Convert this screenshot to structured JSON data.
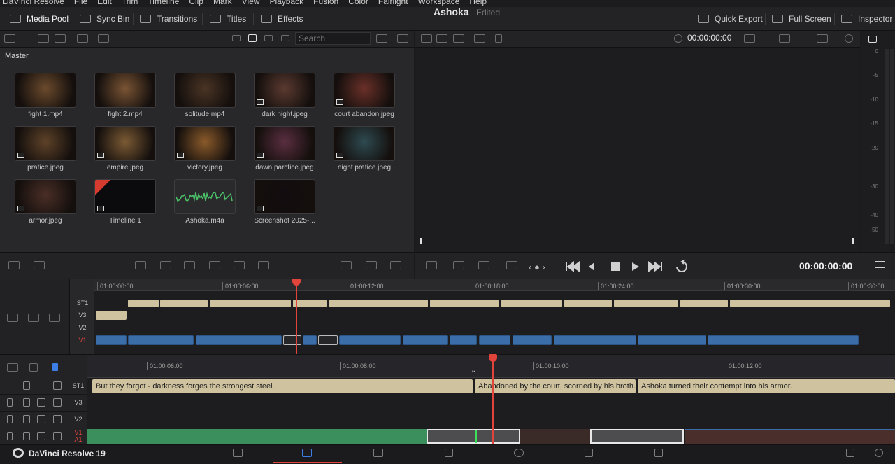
{
  "menu": [
    "DaVinci Resolve",
    "File",
    "Edit",
    "Trim",
    "Timeline",
    "Clip",
    "Mark",
    "View",
    "Playback",
    "Fusion",
    "Color",
    "Fairlight",
    "Workspace",
    "Help"
  ],
  "toolbar": {
    "media_pool": "Media Pool",
    "sync_bin": "Sync Bin",
    "transitions": "Transitions",
    "titles": "Titles",
    "effects": "Effects",
    "quick_export": "Quick Export",
    "full_screen": "Full Screen",
    "inspector": "Inspector"
  },
  "project": {
    "title": "Ashoka",
    "status": "Edited"
  },
  "media_pool": {
    "search_placeholder": "Search",
    "bin": "Master",
    "clips": [
      {
        "name": "fight 1.mp4",
        "kind": "video",
        "color": "#6b4a2c"
      },
      {
        "name": "fight 2.mp4",
        "kind": "video",
        "color": "#7a5434"
      },
      {
        "name": "solitude.mp4",
        "kind": "video",
        "color": "#4a3424"
      },
      {
        "name": "dark night.jpeg",
        "kind": "image",
        "color": "#5b3a30"
      },
      {
        "name": "court abandon.jpeg",
        "kind": "image",
        "color": "#6a3028"
      },
      {
        "name": "pratice.jpeg",
        "kind": "image",
        "color": "#5e4228"
      },
      {
        "name": "empire.jpeg",
        "kind": "image",
        "color": "#7b5a34"
      },
      {
        "name": "victory.jpeg",
        "kind": "image",
        "color": "#8a5a2a"
      },
      {
        "name": "dawn parctice.jpeg",
        "kind": "image",
        "color": "#5a2e40"
      },
      {
        "name": "night pratice.jpeg",
        "kind": "image",
        "color": "#2e4a50"
      },
      {
        "name": "armor.jpeg",
        "kind": "image",
        "color": "#4a2e26"
      },
      {
        "name": "Timeline 1",
        "kind": "timeline",
        "color": "#0b0b0d"
      },
      {
        "name": "Ashoka.m4a",
        "kind": "audio",
        "color": "#2a2a2d"
      },
      {
        "name": "Screenshot 2025-...",
        "kind": "image",
        "color": "#120c0e"
      }
    ]
  },
  "viewer": {
    "timecode_top": "00:00:00:00",
    "timecode": "00:00:00:00"
  },
  "meter": [
    "0",
    "-5",
    "-10",
    "-15",
    "-20",
    "-30",
    "-40",
    "-50"
  ],
  "upper_timeline": {
    "ruler": [
      "01:00:00:00",
      "01:00:06:00",
      "01:00:12:00",
      "01:00:18:00",
      "01:00:24:00",
      "01:00:30:00",
      "01:00:36:00"
    ],
    "tracks": [
      "ST1",
      "V3",
      "V2",
      "V1"
    ]
  },
  "lower_timeline": {
    "ruler": [
      "01:00:06:00",
      "01:00:08:00",
      "01:00:10:00",
      "01:00:12:00"
    ],
    "tracks": [
      "ST1",
      "V3",
      "V2",
      "V1",
      "A1"
    ],
    "subtitles": [
      "But they forgot - darkness forges the strongest steel.",
      "Abandoned by the court, scorned by his broth...",
      "Ashoka turned their contempt into his armor."
    ]
  },
  "footer": {
    "brand": "DaVinci Resolve 19"
  }
}
